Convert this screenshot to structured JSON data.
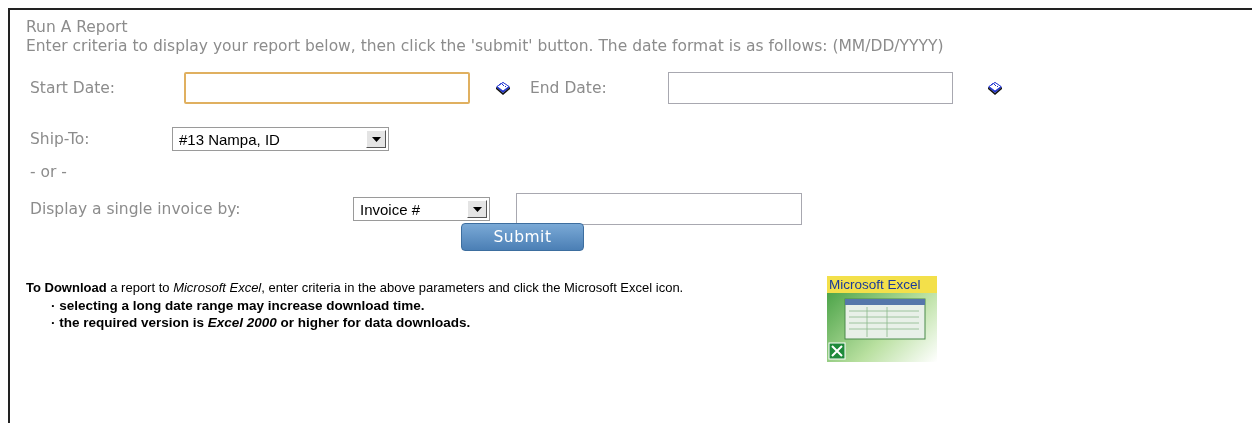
{
  "title": "Run A Report",
  "intro": "Enter criteria to display your report below, then click the 'submit' button. The date format is as follows: (MM/DD/YYYY)",
  "start_date": {
    "label": "Start Date:",
    "focused": true
  },
  "end_date": {
    "label": "End Date:",
    "focused": false
  },
  "ship_to": {
    "label": "Ship-To:",
    "value": "#13 Nampa, ID"
  },
  "separator": "- or -",
  "invoice": {
    "label": "Display a single invoice by:",
    "by_value": "Invoice #"
  },
  "submit": "Submit",
  "download": {
    "text": "**To Download** a report to *Microsoft Excel*, enter criteria in the above parameters and click the Microsoft Excel icon.",
    "bullets": [
      "· selecting a long date range may increase download time.",
      "· the required version is *Excel 2000* or higher for data downloads."
    ]
  },
  "excel_logo": {
    "label": "Microsoft Excel"
  }
}
